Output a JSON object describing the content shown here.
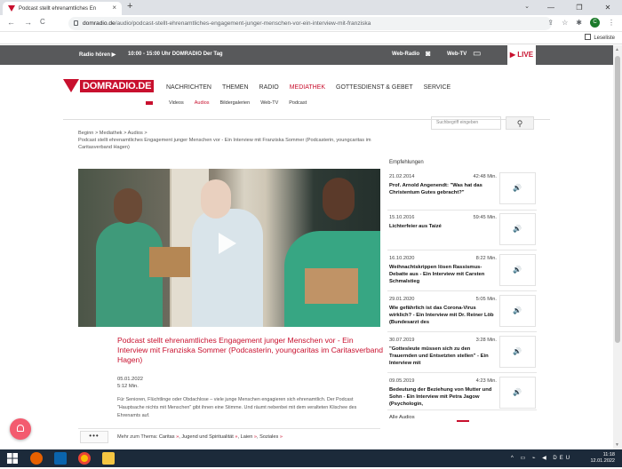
{
  "browser": {
    "tab_title": "Podcast stellt ehrenamtliches En",
    "tab_close": "×",
    "new_tab": "+",
    "tab_search": "⌄",
    "win_min": "—",
    "win_max": "❐",
    "win_close": "✕",
    "back": "←",
    "forward": "→",
    "reload": "C",
    "url_domain": "domradio.de",
    "url_path": "/audio/podcast-stellt-ehrenamtliches-engagement-junger-menschen-vor-ein-interview-mit-franziska",
    "share_icon": "⇪",
    "star_icon": "☆",
    "ext_icon": "✱",
    "avatar": "C",
    "menu_icon": "⋮",
    "reading_list": "Leseliste"
  },
  "topbar": {
    "radio_label": "Radio hören  ▶",
    "program": "10:00 - 15:00 Uhr DOMRADIO Der Tag",
    "webradio": "Web-Radio",
    "webradio_icon": "◙",
    "webtv": "Web-TV",
    "webtv_icon": "▭",
    "live": "▶ LIVE"
  },
  "site": {
    "logo": "DOMRADIO.DE",
    "nav": [
      "NACHRICHTEN",
      "THEMEN",
      "RADIO",
      "MEDIATHEK",
      "GOTTESDIENST & GEBET",
      "SERVICE"
    ],
    "subnav": [
      "Videos",
      "Audios",
      "Bildergalerien",
      "Web-TV",
      "Podcast"
    ],
    "search_placeholder": "Suchbegriff eingeben",
    "search_icon": "⚲"
  },
  "breadcrumb": {
    "line1": "Beginn > Mediathek > Audios >",
    "line2": "Podcast stellt ehrenamtliches Engagement junger Menschen vor - Ein Interview mit Franziska Sommer (Podcasterin, youngcaritas im",
    "line3": "Caritasverband Hagen)"
  },
  "article": {
    "title": "Podcast stellt ehrenamtliches Engagement junger Menschen vor - Ein Interview mit Franziska Sommer (Podcasterin, youngcaritas im Caritasverband Hagen)",
    "date": "05.01.2022",
    "duration": "5:12 Min.",
    "description": "Für Senioren, Flüchtlinge oder Obdachlose – viele junge Menschen engagieren sich ehrenamtlich. Der Podcast \"Hauptsache nichts mit Menschen\" gibt ihnen eine Stimme. Und räumt nebenbei mit dem veralteten Klischee des Ehrenamts auf.",
    "more_button": "•••",
    "topics_label": "Mehr zum Thema:",
    "topics": [
      "Caritas",
      "Jugend und Spiritualität",
      "Laien",
      "Soziales"
    ],
    "topic_arrow": "»"
  },
  "recommendations": {
    "heading": "Empfehlungen",
    "play_icon": "🔊",
    "items": [
      {
        "date": "21.02.2014",
        "duration": "42:48 Min.",
        "title": "Prof. Arnold Angenendt: \"Was hat das Christentum Gutes gebracht?\""
      },
      {
        "date": "15.10.2016",
        "duration": "59:45 Min.",
        "title": "Lichterfeier aus Taizé"
      },
      {
        "date": "16.10.2020",
        "duration": "8:22 Min.",
        "title": "Weihnachtskrippen lösen Rassismus-Debatte aus - Ein Interview mit Carsten Schmalstieg"
      },
      {
        "date": "29.01.2020",
        "duration": "5:05 Min.",
        "title": "Wie gefährlich ist das Corona-Virus wirklich? - Ein Interview mit Dr. Reiner Löb (Bundesarzt des"
      },
      {
        "date": "30.07.2019",
        "duration": "3:28 Min.",
        "title": "\"Gottesleute müssen sich zu den Trauernden und Entsetzten stellen\" - Ein Interview mit"
      },
      {
        "date": "09.05.2019",
        "duration": "4:23 Min.",
        "title": "Bedeutung der Beziehung von Mutter und Sohn - Ein Interview mit Petra Jagow (Psychologin,"
      }
    ],
    "all_audios": "Alle Audios"
  },
  "taskbar": {
    "time": "11:18",
    "date": "12.01.2022",
    "tray": "^ ▭ ⌁ ◀ DEU"
  }
}
